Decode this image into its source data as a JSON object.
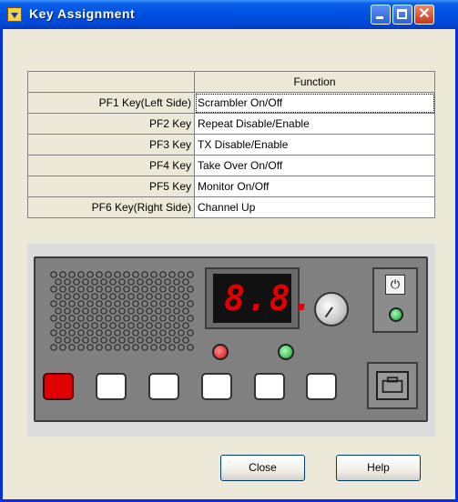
{
  "window": {
    "title": "Key Assignment",
    "controls": {
      "minimize": "minimize",
      "maximize": "maximize",
      "close": "✕"
    }
  },
  "table": {
    "header_function": "Function",
    "rows": [
      {
        "key": "PF1 Key(Left Side)",
        "function": "Scrambler On/Off"
      },
      {
        "key": "PF2 Key",
        "function": "Repeat Disable/Enable"
      },
      {
        "key": "PF3 Key",
        "function": "TX Disable/Enable"
      },
      {
        "key": "PF4 Key",
        "function": "Take Over On/Off"
      },
      {
        "key": "PF5 Key",
        "function": "Monitor On/Off"
      },
      {
        "key": "PF6 Key(Right Side)",
        "function": "Channel Up"
      }
    ]
  },
  "radio_panel": {
    "display": "8.8.",
    "power_symbol": "⏻",
    "active_pf_key": "PF1",
    "colors": {
      "led_red": "#e00000",
      "led_green": "#19a12e",
      "panel": "#808080"
    }
  },
  "buttons": {
    "close_label": "Close",
    "help_label": "Help"
  }
}
